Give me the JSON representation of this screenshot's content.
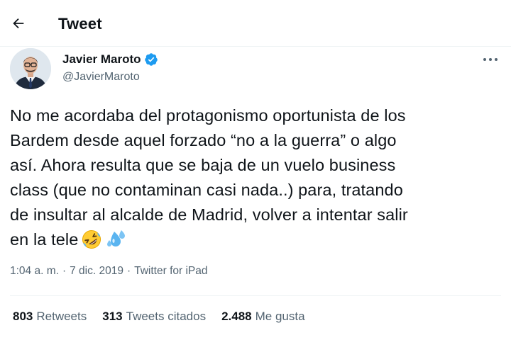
{
  "header": {
    "title": "Tweet"
  },
  "author": {
    "name": "Javier Maroto",
    "handle": "@JavierMaroto",
    "verified": true
  },
  "tweet": {
    "lines": [
      "No me acordaba del protagonismo oportunista de los",
      "Bardem desde aquel forzado “no a la guerra” o algo",
      "así. Ahora resulta que se baja de un vuelo business",
      "class (que no contaminan casi nada..) para, tratando",
      "de insultar al alcalde de Madrid, volver a intentar salir",
      "en la tele"
    ],
    "emojis": [
      "rolling-on-floor-laughing-emoji",
      "sweat-droplets-emoji"
    ]
  },
  "meta": {
    "time": "1:04 a. m.",
    "separator": "·",
    "date": "7 dic. 2019",
    "source": "Twitter for iPad"
  },
  "stats": [
    {
      "count": "803",
      "label": "Retweets"
    },
    {
      "count": "313",
      "label": "Tweets citados"
    },
    {
      "count": "2.488",
      "label": "Me gusta"
    }
  ],
  "colors": {
    "text": "#0f1419",
    "secondary": "#536471",
    "verified": "#1d9bf0",
    "divider": "#eff3f4"
  }
}
